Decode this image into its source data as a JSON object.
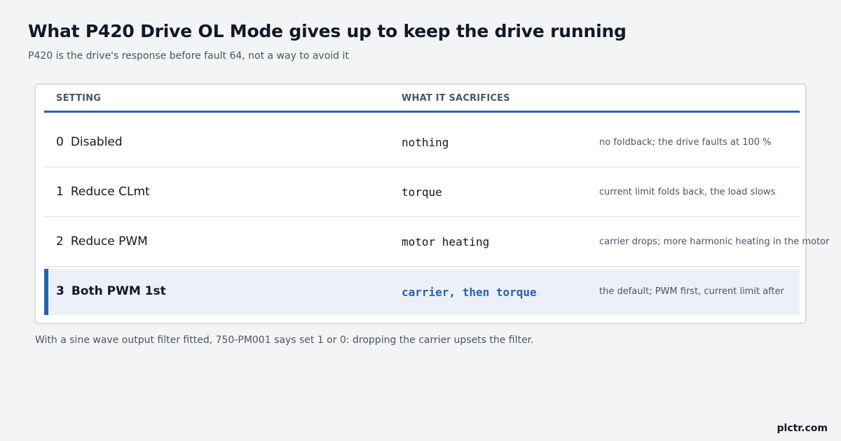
{
  "header": {
    "title": "What P420 Drive OL Mode gives up to keep the drive running",
    "subtitle": "P420 is the drive's response before fault 64, not a way to avoid it"
  },
  "table": {
    "columns": [
      "SETTING",
      "WHAT IT SACRIFICES"
    ],
    "rows": [
      {
        "num": "0",
        "setting": "Disabled",
        "sacrifice": "nothing",
        "note": "no foldback; the drive faults at 100 %"
      },
      {
        "num": "1",
        "setting": "Reduce CLmt",
        "sacrifice": "torque",
        "note": "current limit folds back, the load slows"
      },
      {
        "num": "2",
        "setting": "Reduce PWM",
        "sacrifice": "motor heating",
        "note": "carrier drops; more harmonic heating in the motor"
      },
      {
        "num": "3",
        "setting": "Both PWM 1st",
        "sacrifice": "carrier, then torque",
        "note": "the default; PWM first, current limit after",
        "highlighted": true
      }
    ]
  },
  "footnote": "With a sine wave output filter fitted, 750-PM001 says set 1 or 0: dropping the carrier upsets the filter.",
  "brand": "plctr.com",
  "colors": {
    "accent": "#2563ae",
    "highlight_row": "#ecf1f9",
    "background": "#f3f4f6"
  }
}
